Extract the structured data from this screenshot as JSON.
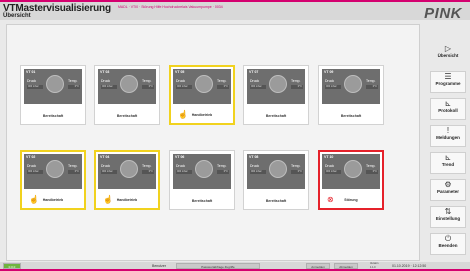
{
  "header": {
    "app_title": "VTMastervisualisierung",
    "page_title": "Übersicht",
    "marquee": "MADL · VTI0 · Störung Hilfe Hochdruckrelais Vakuumpumpe · 0034",
    "logo": "PINK"
  },
  "panel_labels": {
    "pressure": "Druck",
    "temp": "Temp."
  },
  "stations": [
    {
      "name": "VT 01",
      "p": "000 mbar",
      "t": "0°C",
      "status": "Bereitschaft",
      "state": "normal",
      "hand": false
    },
    {
      "name": "VT 03",
      "p": "000 mbar",
      "t": "0°C",
      "status": "Bereitschaft",
      "state": "normal",
      "hand": false
    },
    {
      "name": "VT 05",
      "p": "000 mbar",
      "t": "0°C",
      "status": "Handbetrieb",
      "state": "selected",
      "hand": true
    },
    {
      "name": "VT 07",
      "p": "000 mbar",
      "t": "0°C",
      "status": "Bereitschaft",
      "state": "normal",
      "hand": false
    },
    {
      "name": "VT 09",
      "p": "000 mbar",
      "t": "0°C",
      "status": "Bereitschaft",
      "state": "normal",
      "hand": false
    },
    {
      "name": "VT 02",
      "p": "000 mbar",
      "t": "0°C",
      "status": "Handbetrieb",
      "state": "selected",
      "hand": true
    },
    {
      "name": "VT 04",
      "p": "000 mbar",
      "t": "0°C",
      "status": "Handbetrieb",
      "state": "selected",
      "hand": true
    },
    {
      "name": "VT 06",
      "p": "000 mbar",
      "t": "0°C",
      "status": "Bereitschaft",
      "state": "normal",
      "hand": false
    },
    {
      "name": "VT 08",
      "p": "000 mbar",
      "t": "0°C",
      "status": "Bereitschaft",
      "state": "normal",
      "hand": false
    },
    {
      "name": "VT 10",
      "p": "000 mbar",
      "t": "0°C",
      "status": "Störung",
      "state": "error",
      "hand": true
    }
  ],
  "sidebar": [
    {
      "label": "Übersicht",
      "icon": "▷",
      "icon_name": "play-icon"
    },
    {
      "label": "Programme",
      "icon": "☰",
      "icon_name": "list-icon"
    },
    {
      "label": "Protokoll",
      "icon": "⊾",
      "icon_name": "chart-icon"
    },
    {
      "label": "Meldungen",
      "icon": "!",
      "icon_name": "alert-icon"
    },
    {
      "label": "Trend",
      "icon": "⊾",
      "icon_name": "trend-icon"
    },
    {
      "label": "Parameter",
      "icon": "⚙",
      "icon_name": "gear-icon"
    },
    {
      "label": "Einstellung",
      "icon": "⇅",
      "icon_name": "settings-icon"
    },
    {
      "label": "Beenden",
      "icon": "⏻",
      "icon_name": "power-icon"
    }
  ],
  "footer": {
    "indicator": "0.0.0",
    "user_label": "Benutzer",
    "user": "Passwortabfrage Zugriffe",
    "btn1": "Anmelden",
    "btn2": "Abmelden",
    "version_label": "Version",
    "version": "1.1.0",
    "datetime": "01.10.2019 · 12:12:50"
  }
}
